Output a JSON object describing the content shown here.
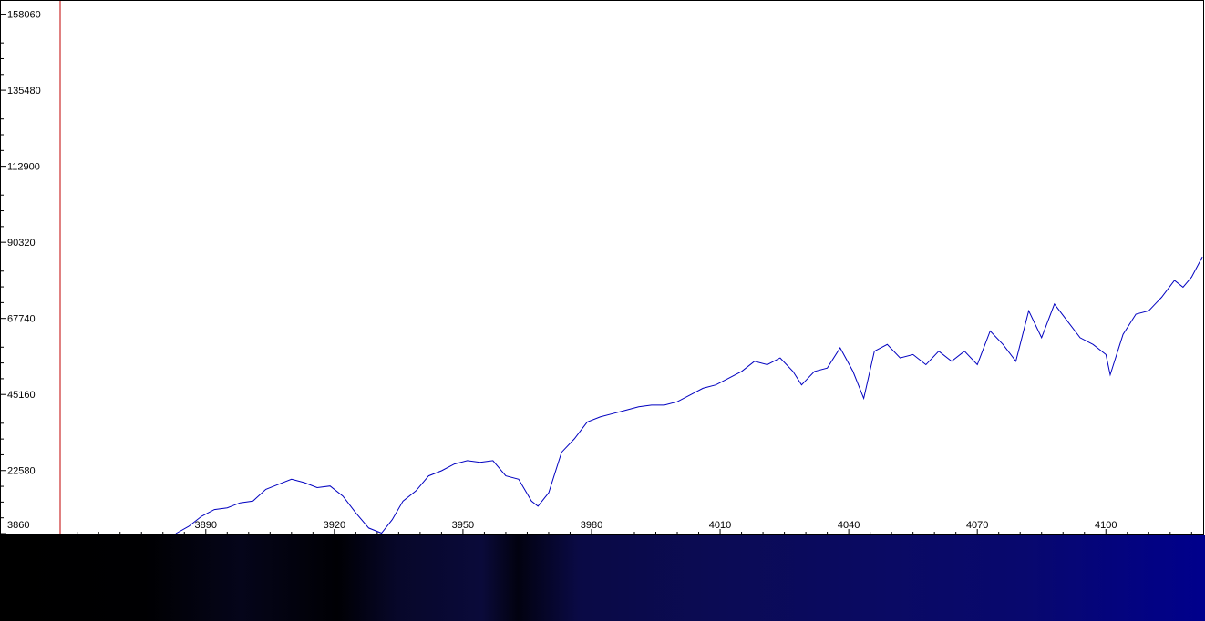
{
  "colors": {
    "background": "#ffffff",
    "frame": "#000000",
    "series_line": "#0000c0",
    "cursor_line": "#c00000",
    "strip_dark": "#000000",
    "strip_blue": "#00008a"
  },
  "chart_data": {
    "type": "line",
    "title": "",
    "xlabel": "",
    "ylabel": "",
    "xlim": [
      3842.2,
      4122.7
    ],
    "ylim": [
      3860,
      162000
    ],
    "x_ticks": [
      3890,
      3920,
      3950,
      3980,
      4010,
      4040,
      4070,
      4100
    ],
    "y_ticks": [
      3860,
      22580,
      45160,
      67740,
      90320,
      112900,
      135480,
      158060
    ],
    "cursor_x": 3842.2,
    "grid": false,
    "legend": "none",
    "series": [
      {
        "x": [
          3883,
          3886,
          3889,
          3892,
          3895,
          3898,
          3901,
          3904,
          3907,
          3910,
          3913,
          3916,
          3919,
          3922,
          3925,
          3928,
          3931,
          3933.5,
          3936,
          3939,
          3942,
          3945,
          3948,
          3951,
          3954,
          3957,
          3960,
          3963,
          3966,
          3967.5,
          3970,
          3973,
          3976,
          3979,
          3982,
          3985,
          3988,
          3991,
          3994,
          3997,
          4000,
          4003,
          4006,
          4009,
          4012,
          4015,
          4018,
          4021,
          4024,
          4027,
          4029,
          4032,
          4035,
          4038,
          4041,
          4043.5,
          4046,
          4049,
          4052,
          4055,
          4058,
          4061,
          4064,
          4067,
          4070,
          4073,
          4076,
          4079,
          4082,
          4085,
          4088,
          4091,
          4094,
          4097,
          4100,
          4101,
          4104,
          4107,
          4110,
          4113,
          4116,
          4118,
          4120,
          4122.5
        ],
        "y": [
          3860,
          6000,
          9000,
          11000,
          11500,
          13000,
          13500,
          17000,
          18500,
          20000,
          19000,
          17500,
          18000,
          15000,
          10000,
          5500,
          4000,
          8000,
          13500,
          16500,
          21000,
          22500,
          24500,
          25500,
          25000,
          25500,
          21000,
          20000,
          13500,
          12000,
          16000,
          28000,
          32000,
          37000,
          38500,
          39500,
          40500,
          41500,
          42000,
          42000,
          43000,
          45000,
          47000,
          48000,
          50000,
          52000,
          55000,
          54000,
          56000,
          52000,
          48000,
          52000,
          53000,
          59000,
          52000,
          44000,
          58000,
          60000,
          56000,
          57000,
          54000,
          58000,
          55000,
          58000,
          54000,
          64000,
          60000,
          55000,
          70000,
          62000,
          72000,
          67000,
          62000,
          60000,
          57000,
          51000,
          63000,
          69000,
          70000,
          74000,
          79000,
          77000,
          80000,
          86000
        ]
      }
    ]
  }
}
